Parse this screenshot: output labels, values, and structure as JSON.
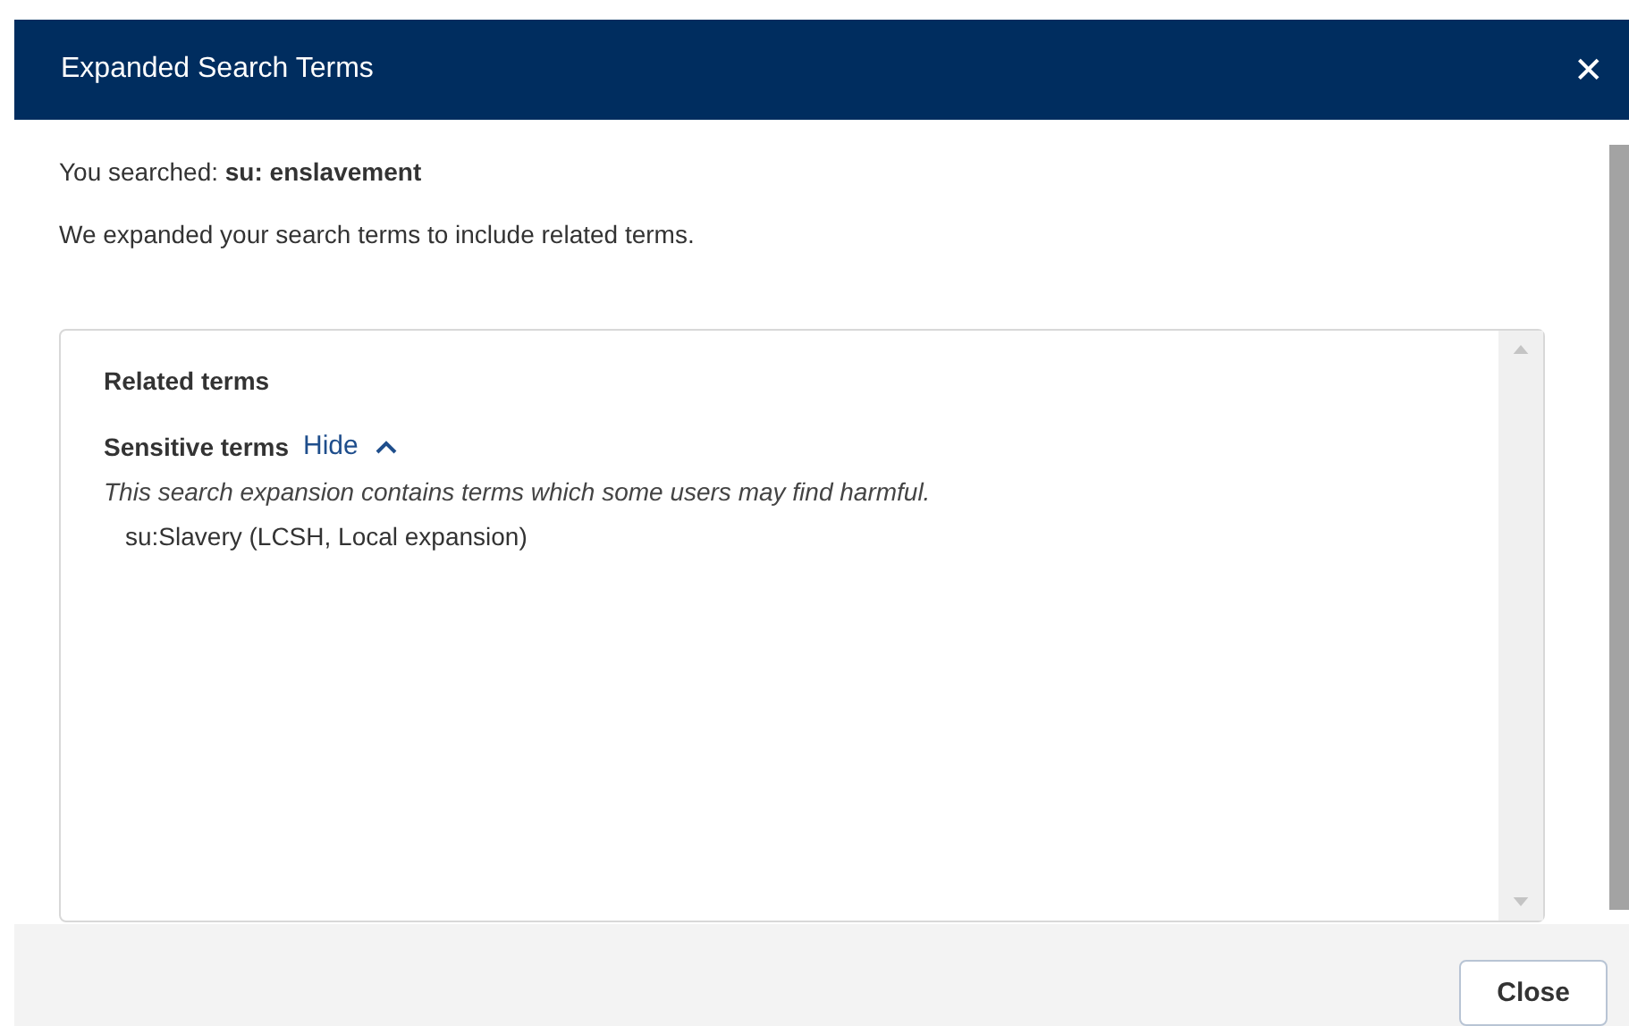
{
  "dialog": {
    "title": "Expanded Search Terms",
    "close_icon": "✕"
  },
  "searched": {
    "label": "You searched:",
    "query": "su: enslavement"
  },
  "message": "We expanded your search terms to include related terms.",
  "related": {
    "heading": "Related terms",
    "groups": [
      {
        "label": "Sensitive terms",
        "toggle": "Hide",
        "expanded": true,
        "note": "This search expansion contains terms which some users may find harmful.",
        "terms": [
          "su:Slavery (LCSH, Local expansion)"
        ]
      }
    ]
  },
  "footer": {
    "button": "Close"
  }
}
